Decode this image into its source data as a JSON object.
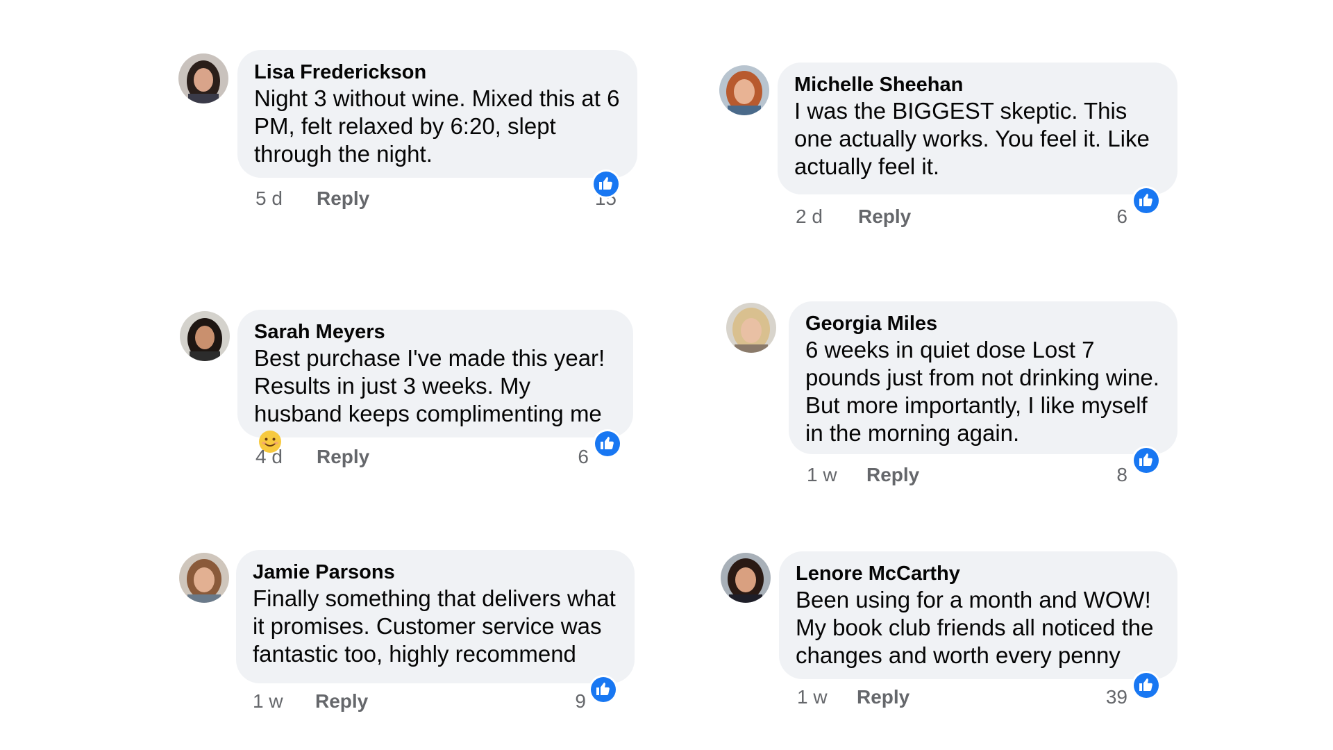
{
  "colors": {
    "bubble": "#f0f2f5",
    "meta_text": "#65676b",
    "like_blue": "#1877f2"
  },
  "comments": [
    {
      "author": "Lisa Frederickson",
      "text": "Night 3 without wine. Mixed this at 6 PM, felt relaxed by 6:20, slept through the night.",
      "time": "5 d",
      "reply": "Reply",
      "likes": "15",
      "icon": "thumbs-up-icon"
    },
    {
      "author": "Michelle Sheehan",
      "text": "I was the BIGGEST skeptic. This one actually works. You feel it. Like actually feel it.",
      "time": "2 d",
      "reply": "Reply",
      "likes": "6",
      "icon": "thumbs-up-icon"
    },
    {
      "author": "Sarah Meyers",
      "text": "Best purchase I've made this year! Results in just 3 weeks. My husband keeps complimenting me",
      "emoji": "smiling-face-emoji",
      "time": "4 d",
      "reply": "Reply",
      "likes": "6",
      "icon": "thumbs-up-icon"
    },
    {
      "author": "Georgia Miles",
      "text": "6 weeks in quiet dose Lost 7 pounds just from not drinking wine. But more importantly, I like myself in the morning again.",
      "time": "1 w",
      "reply": "Reply",
      "likes": "8",
      "icon": "thumbs-up-icon"
    },
    {
      "author": "Jamie Parsons",
      "text": "Finally something that delivers what it promises. Customer service was fantastic too, highly recommend",
      "time": "1 w",
      "reply": "Reply",
      "likes": "9",
      "icon": "thumbs-up-icon"
    },
    {
      "author": "Lenore McCarthy",
      "text": "Been using for a month and WOW! My book club friends all noticed the changes and worth every penny",
      "time": "1 w",
      "reply": "Reply",
      "likes": "39",
      "icon": "thumbs-up-icon"
    }
  ]
}
